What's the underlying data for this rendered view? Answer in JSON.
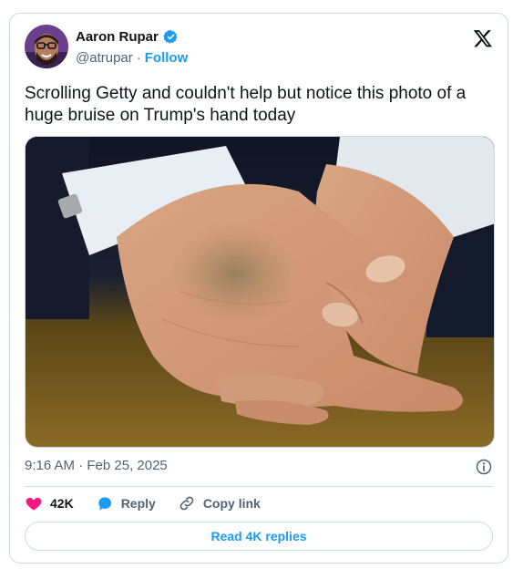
{
  "author": {
    "display_name": "Aaron Rupar",
    "handle": "@atrupar",
    "separator": "·",
    "follow_label": "Follow",
    "verified": true
  },
  "tweet": {
    "text": "Scrolling Getty and couldn't help but notice this photo of a huge bruise on Trump's hand today",
    "timestamp": "9:16 AM · Feb 25, 2025"
  },
  "actions": {
    "like_count": "42K",
    "reply_label": "Reply",
    "copy_label": "Copy link"
  },
  "footer": {
    "read_replies_label": "Read 4K replies"
  },
  "colors": {
    "accent": "#1d9bf0",
    "like": "#f91880",
    "text": "#0f1419",
    "muted": "#536471"
  },
  "icons": [
    "x-logo-icon",
    "verified-badge-icon",
    "info-icon",
    "heart-icon",
    "reply-bubble-icon",
    "link-icon"
  ]
}
